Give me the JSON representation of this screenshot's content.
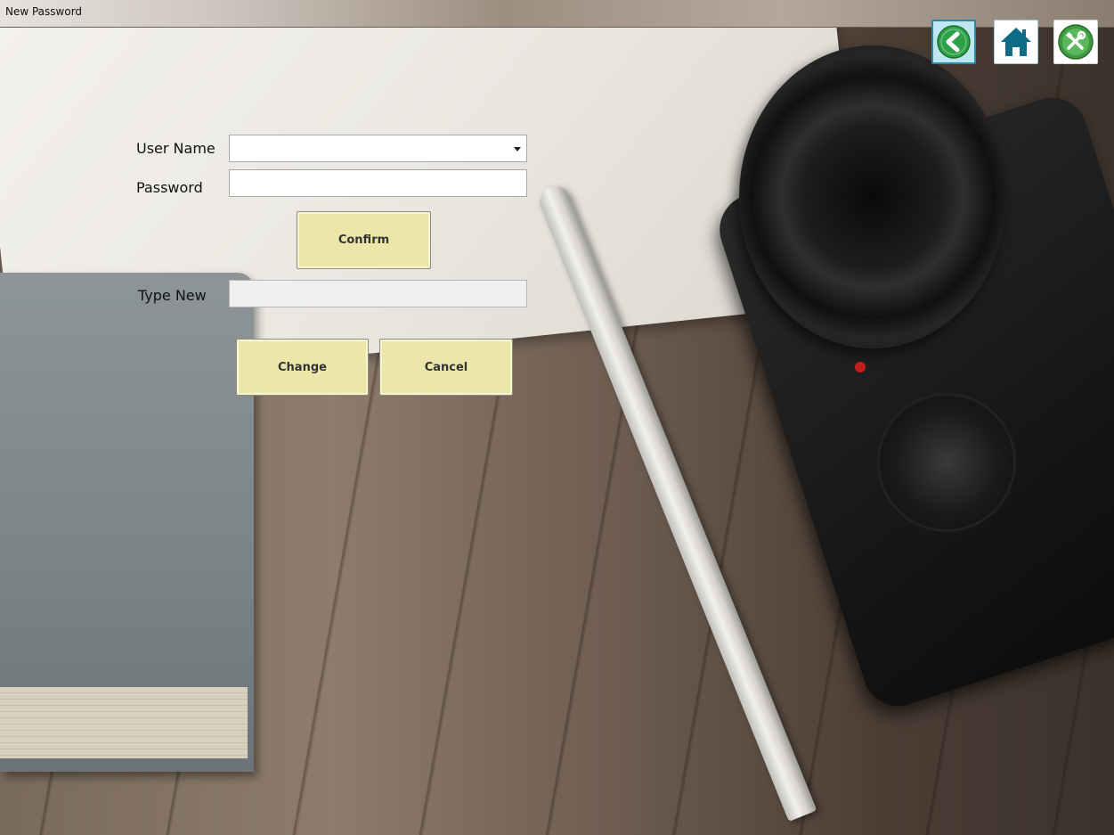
{
  "window": {
    "title": "New Password"
  },
  "nav": {
    "back_icon": "back-arrow-icon",
    "home_icon": "home-icon",
    "tools_icon": "tools-icon",
    "back_color": "#2fa04a",
    "home_color": "#0d6b83",
    "tools_color": "#3e9a3e"
  },
  "form": {
    "username_label": "User Name",
    "username_value": "",
    "password_label": "Password",
    "password_value": "",
    "confirm_label": "Confirm",
    "type_new_label": "Type New",
    "type_new_value": "",
    "change_label": "Change",
    "cancel_label": "Cancel"
  }
}
